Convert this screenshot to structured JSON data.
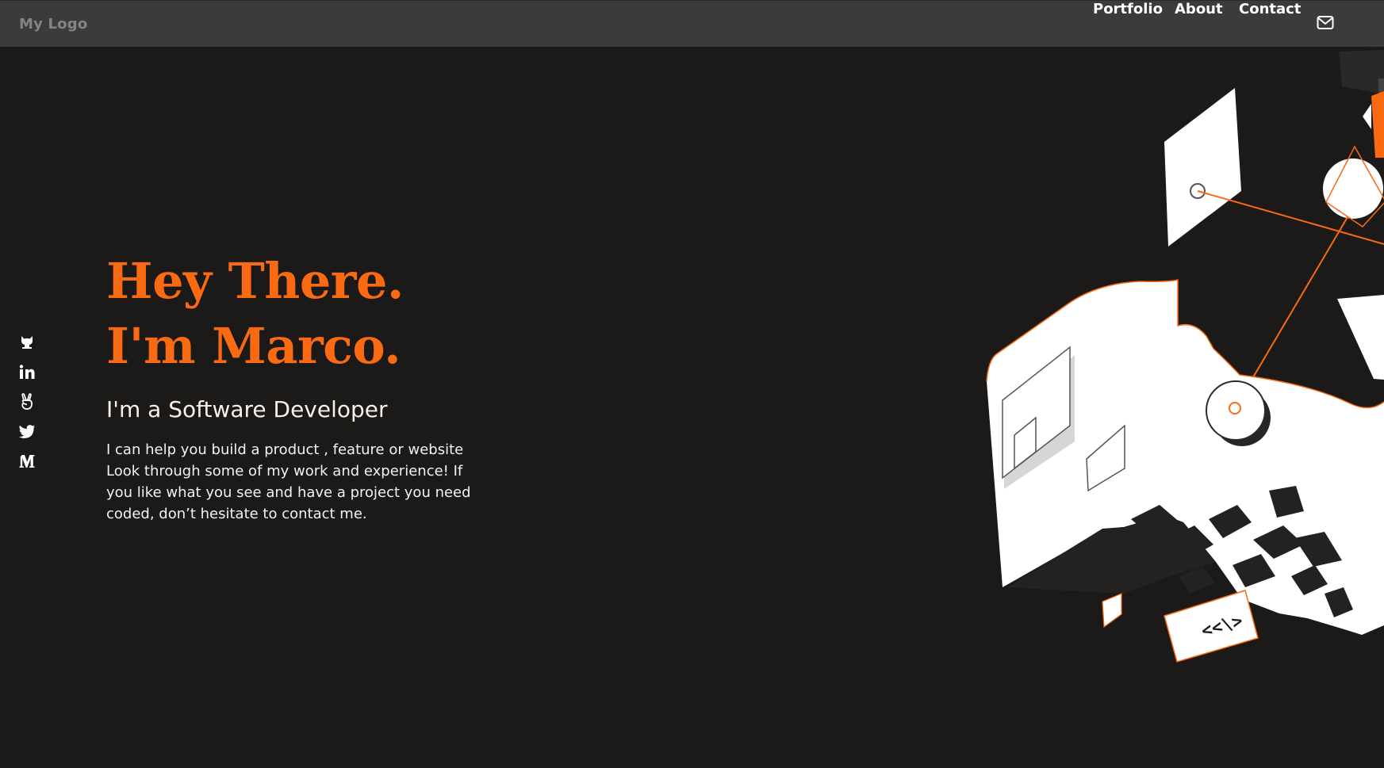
{
  "nav": {
    "logo": "My Logo",
    "links": [
      "Portfolio",
      "About",
      "Contact"
    ],
    "mail_icon": "mail-icon"
  },
  "social": [
    {
      "name": "GitHub",
      "icon": "github-icon"
    },
    {
      "name": "LinkedIn",
      "icon": "linkedin-icon"
    },
    {
      "name": "AngelList",
      "icon": "angellist-icon"
    },
    {
      "name": "Twitter",
      "icon": "twitter-icon"
    },
    {
      "name": "Medium",
      "icon": "medium-icon"
    }
  ],
  "hero": {
    "line1": "Hey There.",
    "line2": "I'm Marco.",
    "role": "I'm a Software Developer",
    "bio": "I can help you build a product , feature or website Look through some of my work and experience! If you like what you see and have a project you need coded, don’t hesitate to contact me."
  },
  "illustration": {
    "code_tag": "<<\\>"
  },
  "colors": {
    "background": "#1b1a19",
    "navbar": "#3c3b3a",
    "accent": "#f96a12",
    "text": "#f2f2f2",
    "muted": "#858483"
  }
}
